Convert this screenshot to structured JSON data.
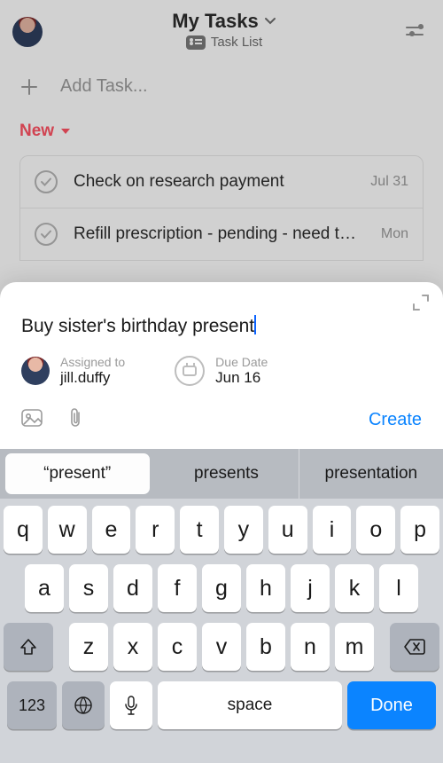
{
  "header": {
    "title": "My Tasks",
    "subtitle": "Task List"
  },
  "addTask": {
    "placeholder": "Add Task..."
  },
  "section": {
    "name": "New"
  },
  "tasks": [
    {
      "title": "Check on research payment",
      "date": "Jul 31"
    },
    {
      "title": "Refill prescription - pending - need to wait",
      "date": "Mon"
    }
  ],
  "quickAdd": {
    "text": "Buy sister's birthday present",
    "assignedLabel": "Assigned to",
    "assignedValue": "jill.duffy",
    "dueLabel": "Due Date",
    "dueValue": "Jun 16",
    "createLabel": "Create"
  },
  "keyboard": {
    "suggestions": [
      "present",
      "presents",
      "presentation"
    ],
    "row1": [
      "q",
      "w",
      "e",
      "r",
      "t",
      "y",
      "u",
      "i",
      "o",
      "p"
    ],
    "row2": [
      "a",
      "s",
      "d",
      "f",
      "g",
      "h",
      "j",
      "k",
      "l"
    ],
    "row3": [
      "z",
      "x",
      "c",
      "v",
      "b",
      "n",
      "m"
    ],
    "numKey": "123",
    "space": "space",
    "done": "Done"
  }
}
